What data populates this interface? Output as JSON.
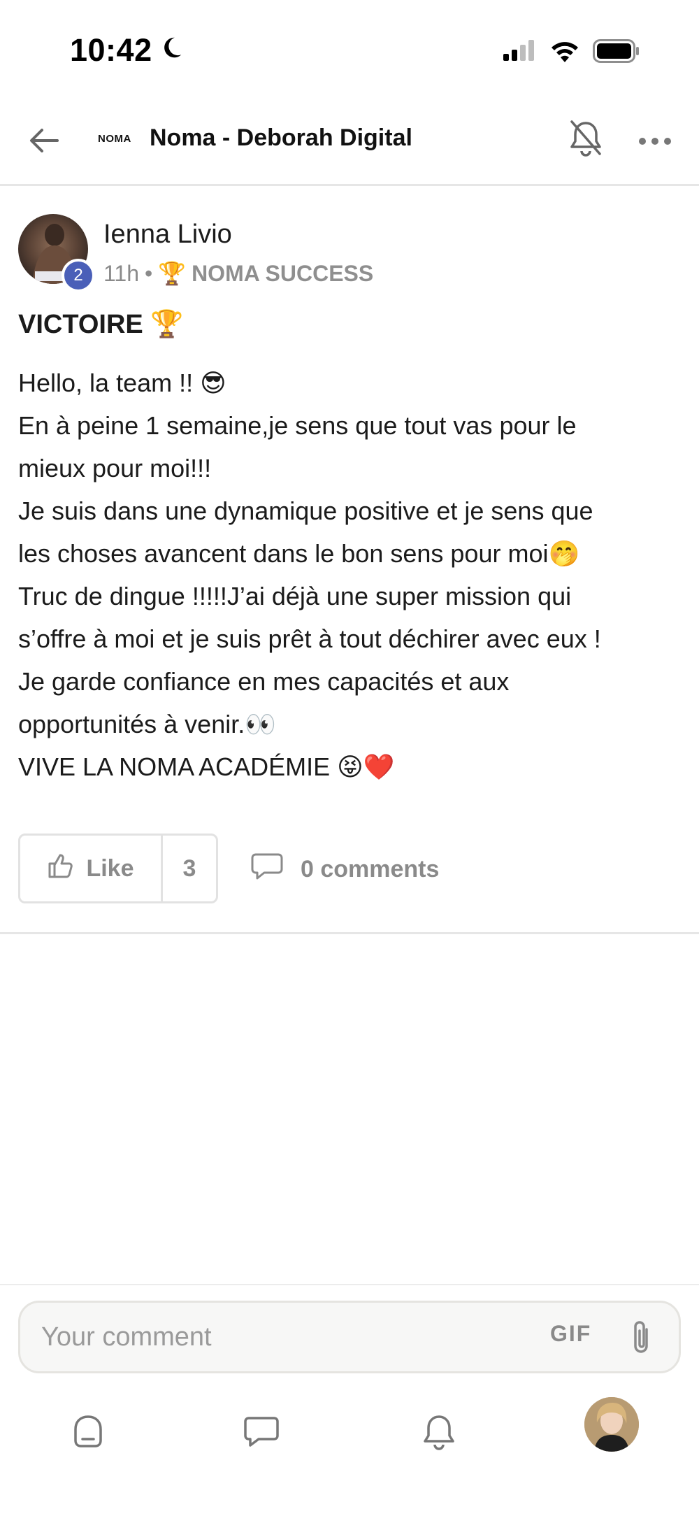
{
  "status_bar": {
    "time": "10:42",
    "icons": [
      "moon-icon",
      "signal-icon",
      "wifi-icon",
      "battery-icon"
    ]
  },
  "header": {
    "logo_text": "NOMA",
    "title": "Noma - Deborah Digital",
    "icons": [
      "back-arrow-icon",
      "bell-off-icon",
      "more-icon"
    ]
  },
  "post": {
    "author": "Ienna Livio",
    "level_badge": "2",
    "time": "11h",
    "meta_separator": "•",
    "space_emoji": "🏆",
    "space_name": "NOMA SUCCESS",
    "title": "VICTOIRE 🏆",
    "body_lines": [
      "Hello, la team !! 😎",
      "En à peine 1 semaine,je sens que tout vas pour le",
      "mieux pour moi!!!",
      "Je suis dans une dynamique positive et je sens que",
      "les choses avancent dans le bon sens pour moi🤭",
      "Truc de dingue !!!!!J’ai déjà une super mission qui",
      "s’offre à moi et je suis prêt à tout déchirer avec eux !",
      "Je garde confiance en mes capacités et aux",
      "opportunités à venir.👀",
      "VIVE LA NOMA ACADÉMIE 😝❤️"
    ],
    "like_label": "Like",
    "like_count": "3",
    "comments_label": "0 comments"
  },
  "comment_bar": {
    "placeholder": "Your comment",
    "gif_label": "GIF"
  },
  "bottom_nav": {
    "items": [
      "home-icon",
      "chat-icon",
      "notifications-icon",
      "profile-avatar"
    ]
  },
  "colors": {
    "accent_badge": "#4a5fb8",
    "muted_text": "#8a8a8a",
    "divider": "#e6e6e6"
  }
}
